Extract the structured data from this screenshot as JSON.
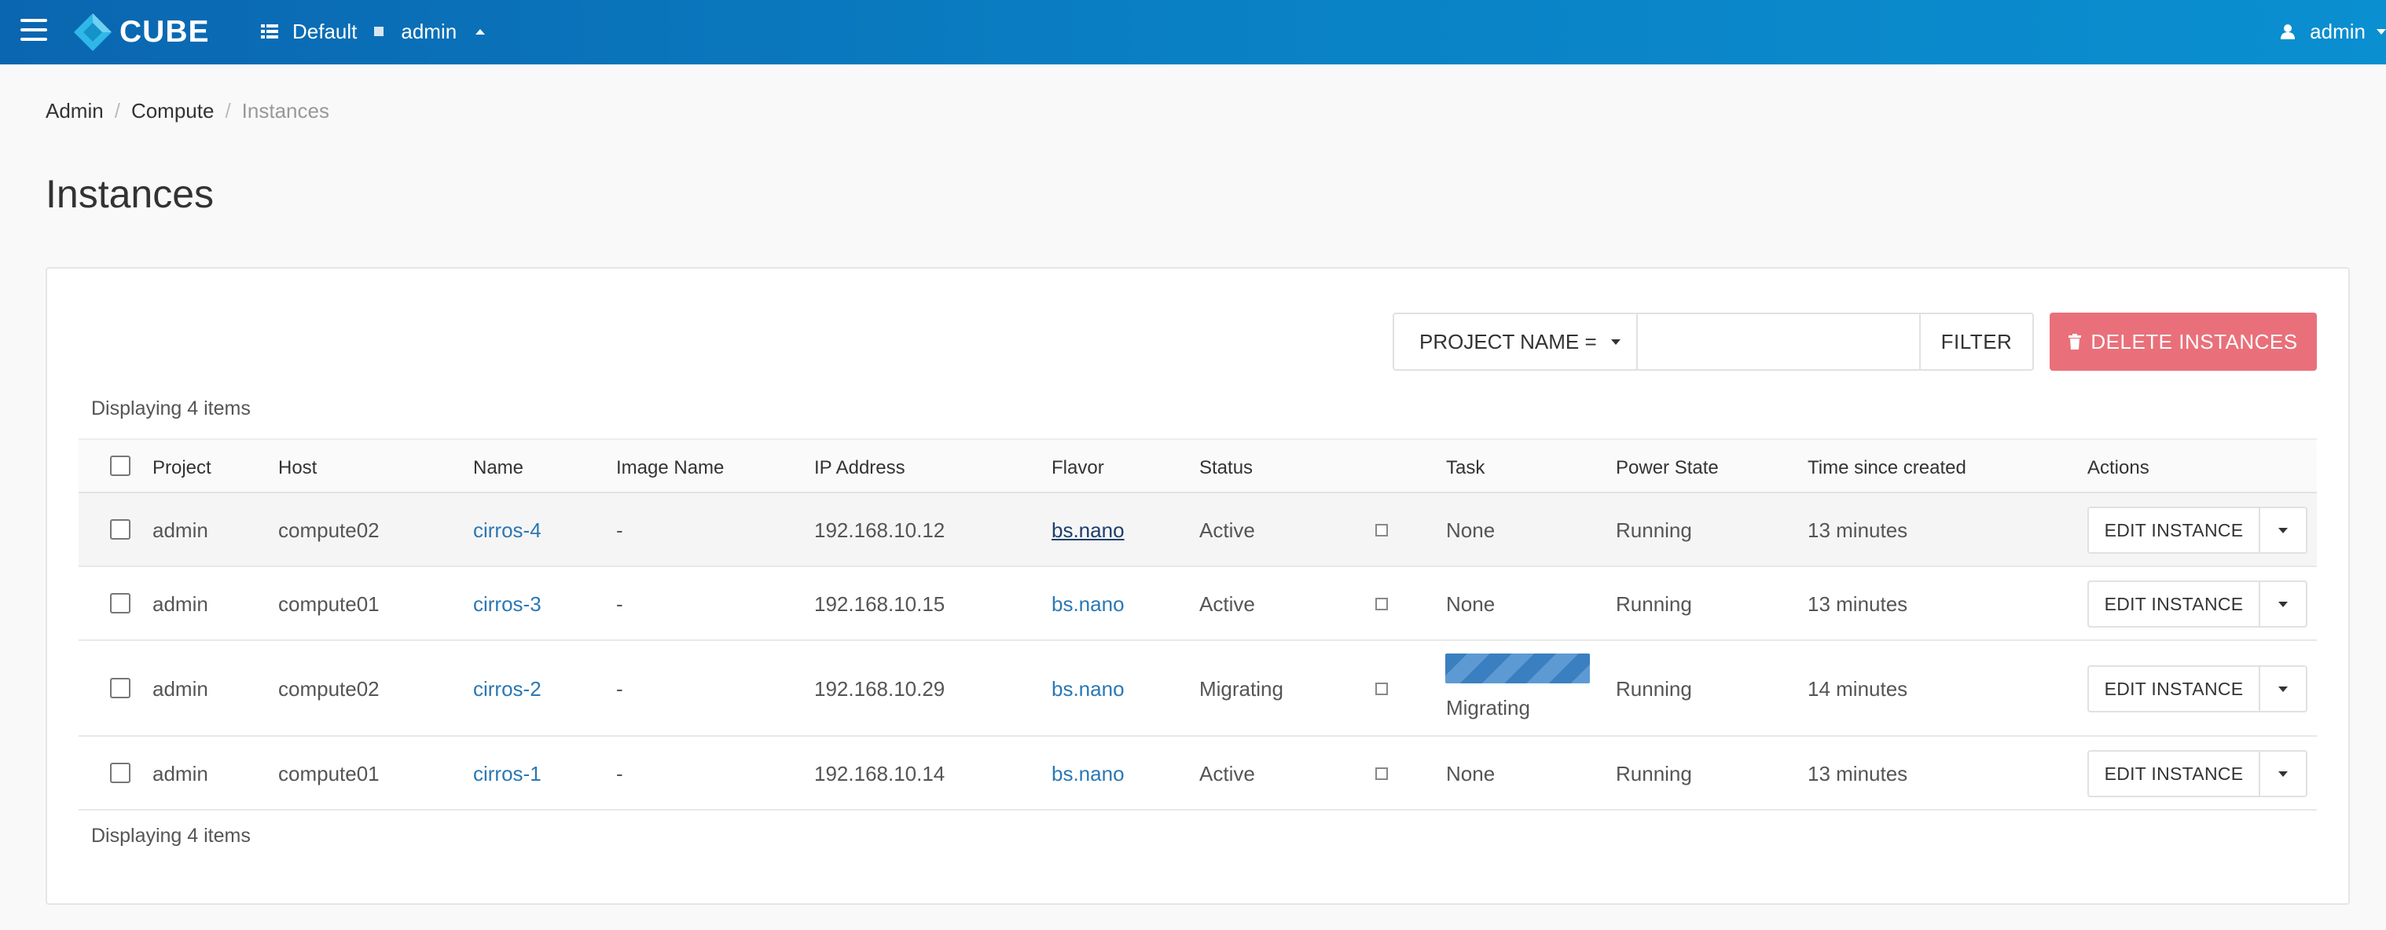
{
  "topbar": {
    "brand": "CUBE",
    "domain": "Default",
    "project": "admin",
    "user": "admin",
    "colors": {
      "bar": "#0a80c4",
      "logo": "#2fb7e8"
    }
  },
  "breadcrumb": {
    "items": [
      "Admin",
      "Compute"
    ],
    "current": "Instances"
  },
  "page": {
    "title": "Instances"
  },
  "filter": {
    "field_label": "PROJECT NAME =",
    "input_value": "",
    "input_placeholder": "",
    "filter_label": "FILTER",
    "delete_label": "DELETE INSTANCES",
    "delete_color": "#e9707a"
  },
  "table": {
    "count_text": "Displaying 4 items",
    "headers": {
      "project": "Project",
      "host": "Host",
      "name": "Name",
      "image": "Image Name",
      "ip": "IP Address",
      "flavor": "Flavor",
      "status": "Status",
      "task": "Task",
      "power": "Power State",
      "time": "Time since created",
      "actions": "Actions"
    },
    "rows": [
      {
        "project": "admin",
        "host": "compute02",
        "name": "cirros-4",
        "image": "-",
        "ip": "192.168.10.12",
        "flavor": "bs.nano",
        "status": "Active",
        "task": "None",
        "power": "Running",
        "time": "13 minutes",
        "action": "EDIT INSTANCE"
      },
      {
        "project": "admin",
        "host": "compute01",
        "name": "cirros-3",
        "image": "-",
        "ip": "192.168.10.15",
        "flavor": "bs.nano",
        "status": "Active",
        "task": "None",
        "power": "Running",
        "time": "13 minutes",
        "action": "EDIT INSTANCE"
      },
      {
        "project": "admin",
        "host": "compute02",
        "name": "cirros-2",
        "image": "-",
        "ip": "192.168.10.29",
        "flavor": "bs.nano",
        "status": "Migrating",
        "task": "Migrating",
        "power": "Running",
        "time": "14 minutes",
        "action": "EDIT INSTANCE"
      },
      {
        "project": "admin",
        "host": "compute01",
        "name": "cirros-1",
        "image": "-",
        "ip": "192.168.10.14",
        "flavor": "bs.nano",
        "status": "Active",
        "task": "None",
        "power": "Running",
        "time": "13 minutes",
        "action": "EDIT INSTANCE"
      }
    ]
  }
}
